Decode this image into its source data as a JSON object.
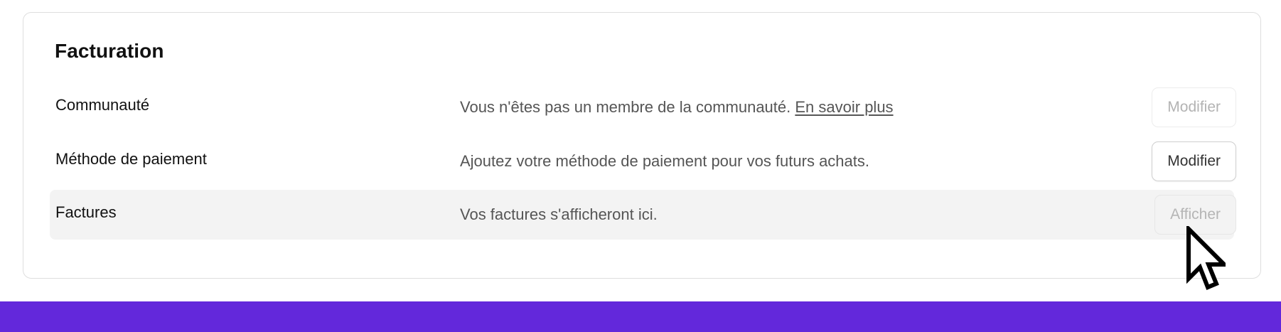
{
  "billing": {
    "title": "Facturation",
    "rows": [
      {
        "label": "Communauté",
        "description": "Vous n'êtes pas un membre de la communauté.",
        "link_text": "En savoir plus",
        "button_label": "Modifier",
        "button_state": "disabled"
      },
      {
        "label": "Méthode de paiement",
        "description": "Ajoutez votre méthode de paiement pour vos futurs achats.",
        "button_label": "Modifier",
        "button_state": "enabled"
      },
      {
        "label": "Factures",
        "description": "Vos factures s'afficheront ici.",
        "button_label": "Afficher",
        "button_state": "disabled"
      }
    ]
  },
  "colors": {
    "accent_bar": "#6328db",
    "row_highlight": "#f3f3f3",
    "border": "#dedede"
  },
  "icons": {
    "cursor": "arrow-cursor-icon"
  }
}
